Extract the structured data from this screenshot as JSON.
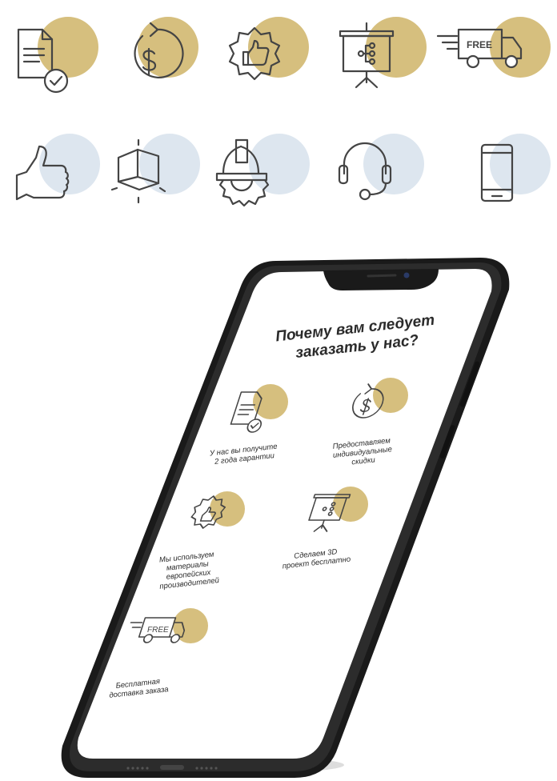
{
  "colors": {
    "gold": "#d6bf7e",
    "blue": "#dde6ef",
    "stroke": "#444444",
    "phone_body": "#1a1a1a",
    "phone_screen": "#ffffff"
  },
  "icon_sheet": {
    "row1": [
      {
        "name": "guarantee-document-icon",
        "accent": "gold"
      },
      {
        "name": "dollar-refresh-icon",
        "accent": "gold"
      },
      {
        "name": "quality-thumb-badge-icon",
        "accent": "gold"
      },
      {
        "name": "presentation-board-icon",
        "accent": "gold"
      },
      {
        "name": "free-delivery-truck-icon",
        "accent": "gold",
        "label": "FREE"
      }
    ],
    "row2": [
      {
        "name": "thumbs-up-icon",
        "accent": "blue"
      },
      {
        "name": "3d-cube-icon",
        "accent": "blue"
      },
      {
        "name": "hard-hat-gear-icon",
        "accent": "blue"
      },
      {
        "name": "headset-icon",
        "accent": "blue"
      },
      {
        "name": "smartphone-icon",
        "accent": "blue"
      }
    ]
  },
  "phone_screen": {
    "heading": "Почему вам следует\nзаказать у нас?",
    "features": [
      {
        "icon": "guarantee-document-icon",
        "caption": "У нас вы получите\n2 года гарантии"
      },
      {
        "icon": "dollar-refresh-icon",
        "caption": "Предоставляем\nиндивидуальные\nскидки"
      },
      {
        "icon": "quality-thumb-badge-icon",
        "caption": "Мы используем\nматериалы\nевропейских\nпроизводителей"
      },
      {
        "icon": "presentation-board-icon",
        "caption": "Сделаем 3D\nпроект бесплатно"
      },
      {
        "icon": "free-delivery-truck-icon",
        "caption": "Бесплатная\nдоставка заказа",
        "label": "FREE"
      }
    ]
  }
}
